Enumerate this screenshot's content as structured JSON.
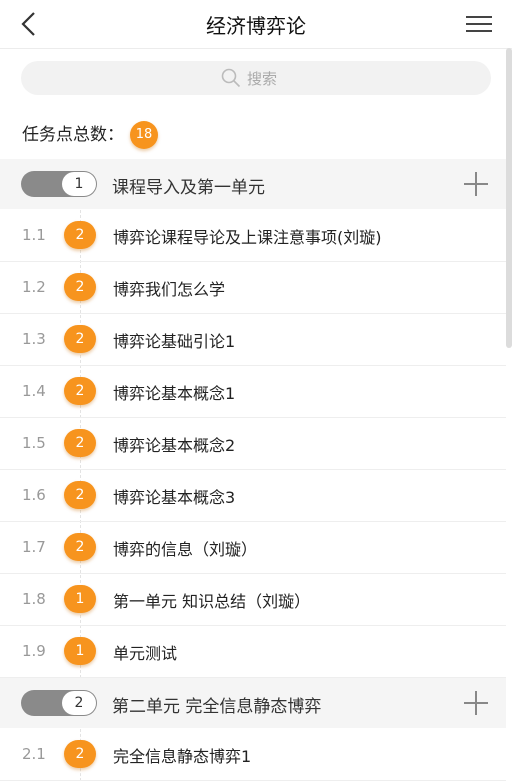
{
  "header": {
    "title": "经济博弈论",
    "back_icon": "chevron-left-icon",
    "menu_icon": "hamburger-menu-icon"
  },
  "search": {
    "placeholder": "搜索",
    "icon": "search-icon"
  },
  "summary": {
    "label": "任务点总数：",
    "count": "18"
  },
  "units": [
    {
      "number": "1",
      "title": "课程导入及第一单元",
      "items": [
        {
          "index": "1.1",
          "tasks": "2",
          "title": "博弈论课程导论及上课注意事项(刘璇)"
        },
        {
          "index": "1.2",
          "tasks": "2",
          "title": "博弈我们怎么学"
        },
        {
          "index": "1.3",
          "tasks": "2",
          "title": "博弈论基础引论1"
        },
        {
          "index": "1.4",
          "tasks": "2",
          "title": "博弈论基本概念1"
        },
        {
          "index": "1.5",
          "tasks": "2",
          "title": "博弈论基本概念2"
        },
        {
          "index": "1.6",
          "tasks": "2",
          "title": "博弈论基本概念3"
        },
        {
          "index": "1.7",
          "tasks": "2",
          "title": "博弈的信息（刘璇）"
        },
        {
          "index": "1.8",
          "tasks": "1",
          "title": "第一单元 知识总结（刘璇）"
        },
        {
          "index": "1.9",
          "tasks": "1",
          "title": "单元测试"
        }
      ]
    },
    {
      "number": "2",
      "title": "第二单元  完全信息静态博弈",
      "items": [
        {
          "index": "2.1",
          "tasks": "2",
          "title": "完全信息静态博弈1"
        }
      ]
    }
  ],
  "colors": {
    "accent": "#f7941e",
    "toggle": "#8a8a8a"
  }
}
